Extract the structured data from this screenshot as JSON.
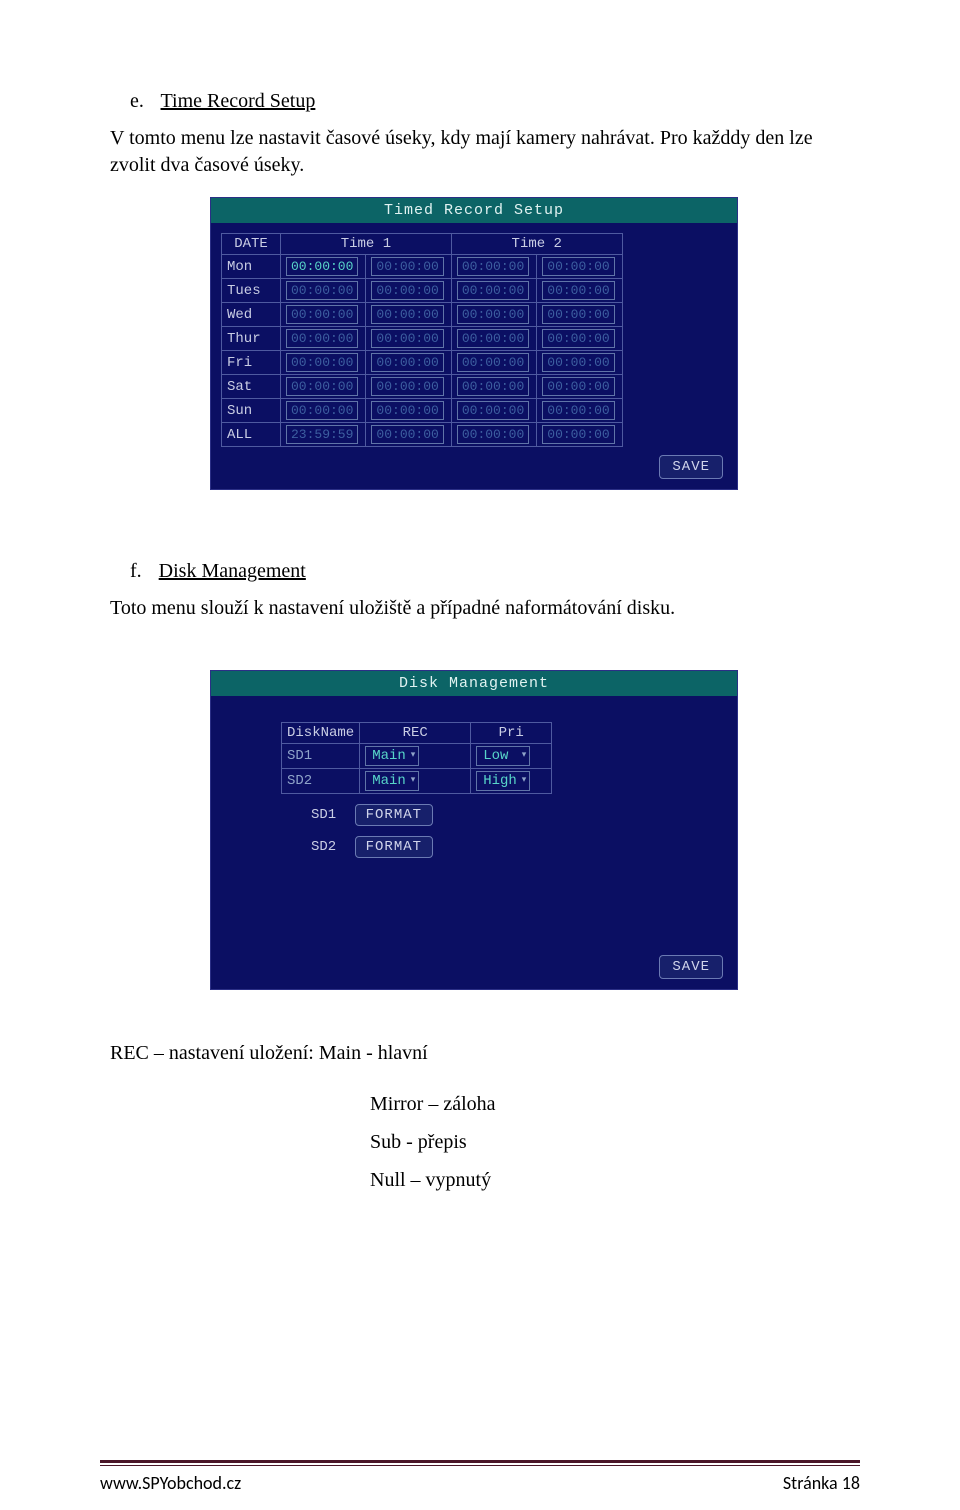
{
  "section_e": {
    "letter": "e.",
    "title": "Time Record Setup",
    "paragraph": "V tomto menu lze nastavit časové úseky, kdy mají kamery nahrávat. Pro každdy den lze zvolit dva časové úseky."
  },
  "timed_shot": {
    "title": "Timed Record Setup",
    "headers": {
      "date": "DATE",
      "time1": "Time 1",
      "time2": "Time 2"
    },
    "rows": [
      {
        "day": "Mon",
        "t1a": "00:00:00",
        "t1b": "00:00:00",
        "t2a": "00:00:00",
        "t2b": "00:00:00",
        "hl": true
      },
      {
        "day": "Tues",
        "t1a": "00:00:00",
        "t1b": "00:00:00",
        "t2a": "00:00:00",
        "t2b": "00:00:00"
      },
      {
        "day": "Wed",
        "t1a": "00:00:00",
        "t1b": "00:00:00",
        "t2a": "00:00:00",
        "t2b": "00:00:00"
      },
      {
        "day": "Thur",
        "t1a": "00:00:00",
        "t1b": "00:00:00",
        "t2a": "00:00:00",
        "t2b": "00:00:00"
      },
      {
        "day": "Fri",
        "t1a": "00:00:00",
        "t1b": "00:00:00",
        "t2a": "00:00:00",
        "t2b": "00:00:00"
      },
      {
        "day": "Sat",
        "t1a": "00:00:00",
        "t1b": "00:00:00",
        "t2a": "00:00:00",
        "t2b": "00:00:00"
      },
      {
        "day": "Sun",
        "t1a": "00:00:00",
        "t1b": "00:00:00",
        "t2a": "00:00:00",
        "t2b": "00:00:00"
      },
      {
        "day": "ALL",
        "t1a": "23:59:59",
        "t1b": "00:00:00",
        "t2a": "00:00:00",
        "t2b": "00:00:00"
      }
    ],
    "save": "SAVE"
  },
  "section_f": {
    "letter": "f.",
    "title": "Disk Management",
    "paragraph": "Toto menu slouží k nastavení uložiště a případné naformátování disku."
  },
  "disk_shot": {
    "title": "Disk Management",
    "headers": {
      "name": "DiskName",
      "rec": "REC",
      "pri": "Pri"
    },
    "rows": [
      {
        "name": "SD1",
        "rec": "Main",
        "pri": "Low"
      },
      {
        "name": "SD2",
        "rec": "Main",
        "pri": "High"
      }
    ],
    "fmt1": {
      "label": "SD1",
      "btn": "FORMAT"
    },
    "fmt2": {
      "label": "SD2",
      "btn": "FORMAT"
    },
    "save": "SAVE"
  },
  "rec_settings": {
    "lead": "REC – nastavení uložení: Main - hlavní",
    "items": [
      "Mirror – záloha",
      "Sub - přepis",
      "Null – vypnutý"
    ]
  },
  "footer": {
    "left": "www.SPYobchod.cz",
    "right": "Stránka 18"
  }
}
